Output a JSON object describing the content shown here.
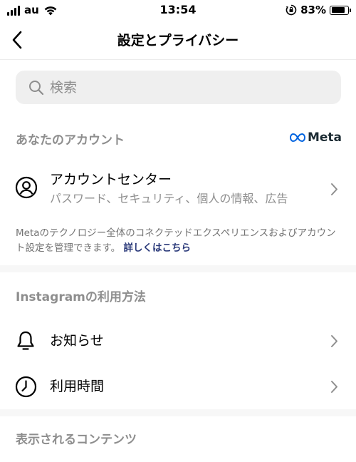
{
  "status_bar": {
    "carrier": "au",
    "time": "13:54",
    "battery_percent": "83%",
    "battery_level": 0.83
  },
  "header": {
    "title": "設定とプライバシー"
  },
  "search": {
    "placeholder": "検索"
  },
  "account_section": {
    "title": "あなたのアカウント",
    "meta_label": "Meta",
    "account_center": {
      "label": "アカウントセンター",
      "subtitle": "パスワード、セキュリティ、個人の情報、広告"
    },
    "description": "Metaのテクノロジー全体のコネクテッドエクスペリエンスおよびアカウント設定を管理できます。",
    "description_link": "詳しくはこちら"
  },
  "usage_section": {
    "title": "Instagramの利用方法",
    "items": [
      {
        "label": "お知らせ",
        "icon": "bell-icon"
      },
      {
        "label": "利用時間",
        "icon": "clock-icon"
      }
    ]
  },
  "content_section": {
    "title": "表示されるコンテンツ"
  }
}
